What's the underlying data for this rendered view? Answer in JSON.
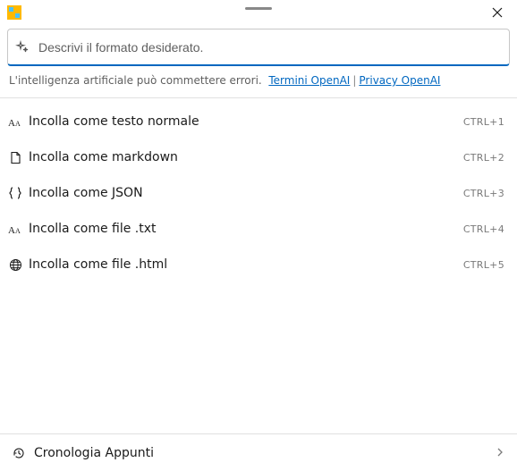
{
  "prompt": {
    "placeholder": "Descrivi il formato desiderato."
  },
  "disclaimer": {
    "text": "L'intelligenza artificiale può commettere errori.",
    "terms_label": "Termini OpenAI",
    "privacy_label": "Privacy OpenAI"
  },
  "options": [
    {
      "icon": "text-size-icon",
      "label": "Incolla come testo normale",
      "shortcut": "CTRL+1"
    },
    {
      "icon": "file-icon",
      "label": "Incolla come markdown",
      "shortcut": "CTRL+2"
    },
    {
      "icon": "braces-icon",
      "label": "Incolla come JSON",
      "shortcut": "CTRL+3"
    },
    {
      "icon": "text-size-icon",
      "label": "Incolla come file .txt",
      "shortcut": "CTRL+4"
    },
    {
      "icon": "globe-icon",
      "label": "Incolla come file .html",
      "shortcut": "CTRL+5"
    }
  ],
  "footer": {
    "label": "Cronologia Appunti"
  }
}
